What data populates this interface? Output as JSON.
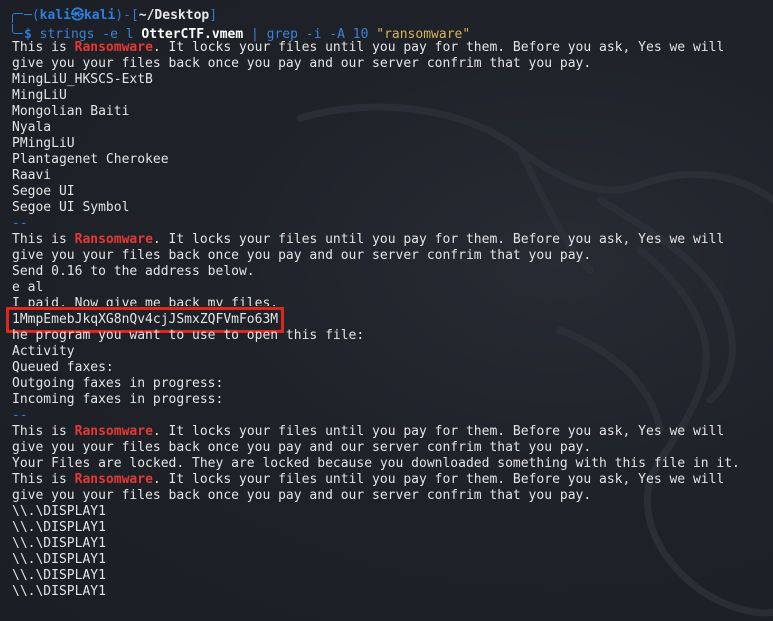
{
  "prompt": {
    "user": "kali",
    "at_symbol": "㉿",
    "host": "kali",
    "path": "~/Desktop",
    "dollar": "$"
  },
  "command": {
    "name": "strings",
    "flag1": "-e l",
    "file": "OtterCTF.vmem",
    "pipe": "|",
    "grep": "grep",
    "flag2": "-i -A 10",
    "pattern": "\"ransomware\""
  },
  "output": {
    "ransom_prefix": "This is ",
    "ransom_word": "Ransomware",
    "ransom_suffix": ". It locks your files until you pay for them. Before you ask, Yes we will",
    "ransom_line2": "give you your files back once you pay and our server confrim that you pay.",
    "fonts": [
      "MingLiU_HKSCS-ExtB",
      "MingLiU",
      "Mongolian Baiti",
      "Nyala",
      "PMingLiU",
      "Plantagenet Cherokee",
      "Raavi",
      "Segoe UI",
      "Segoe UI Symbol"
    ],
    "separator": "--",
    "send_line": "Send 0.16 to the address below.",
    "eal_line": "e al",
    "paid_line": "I paid, Now give me back my files.",
    "address": "1MmpEmebJkqXG8nQv4cjJSmxZQFVmFo63M",
    "program_line": "he program you want to use to open this file:",
    "activity_line": "Activity",
    "queued_line": "Queued faxes:",
    "outgoing_line": "Outgoing faxes in progress:",
    "incoming_line": "Incoming faxes in progress:",
    "locked_line": "Your Files are locked. They are locked because you downloaded something with this file in it.",
    "display_lines": [
      "\\\\.\\DISPLAY1",
      "\\\\.\\DISPLAY1",
      "\\\\.\\DISPLAY1",
      "\\\\.\\DISPLAY1",
      "\\\\.\\DISPLAY1",
      "\\\\.\\DISPLAY1"
    ]
  },
  "colors": {
    "background": "#1e2127",
    "prompt": "#2e7bd8",
    "highlight": "#e53935",
    "box": "#e0271e",
    "string": "#d8b45a"
  },
  "icons": {
    "wallpaper": "kali-dragon-icon"
  }
}
